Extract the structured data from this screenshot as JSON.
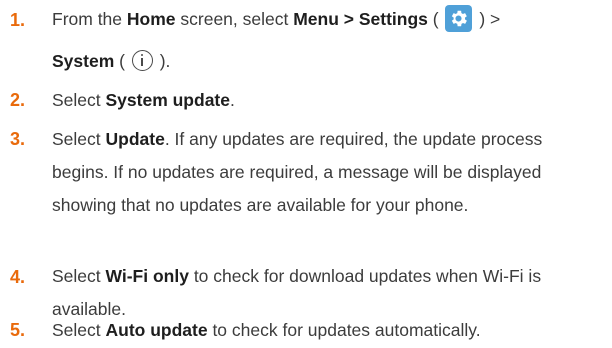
{
  "steps": [
    {
      "number": "1.",
      "parts": {
        "t1": "From the ",
        "b1": "Home",
        "t2": " screen, select ",
        "b2": "Menu > Settings",
        "t3": " ( ",
        "t4": " ) >",
        "b3": "System",
        "t5": " ( ",
        "t6": " )."
      }
    },
    {
      "number": "2.",
      "parts": {
        "t1": "Select ",
        "b1": "System update",
        "t2": "."
      }
    },
    {
      "number": "3.",
      "parts": {
        "t1": "Select ",
        "b1": "Update",
        "t2": ". If any updates are required, the update process begins. If no updates are required, a message will be displayed showing that no updates are available for your phone."
      }
    },
    {
      "number": "4.",
      "parts": {
        "t1": "Select ",
        "b1": "Wi-Fi only",
        "t2": " to check for download updates when Wi-Fi is available."
      }
    },
    {
      "number": "5.",
      "parts": {
        "t1": "Select ",
        "b1": "Auto update",
        "t2": " to check for updates automatically."
      }
    }
  ],
  "icons": {
    "settings": "gear-icon",
    "system": "info-icon"
  },
  "colors": {
    "step_number": "#e96a0b",
    "settings_icon_bg": "#4fa0d8"
  }
}
